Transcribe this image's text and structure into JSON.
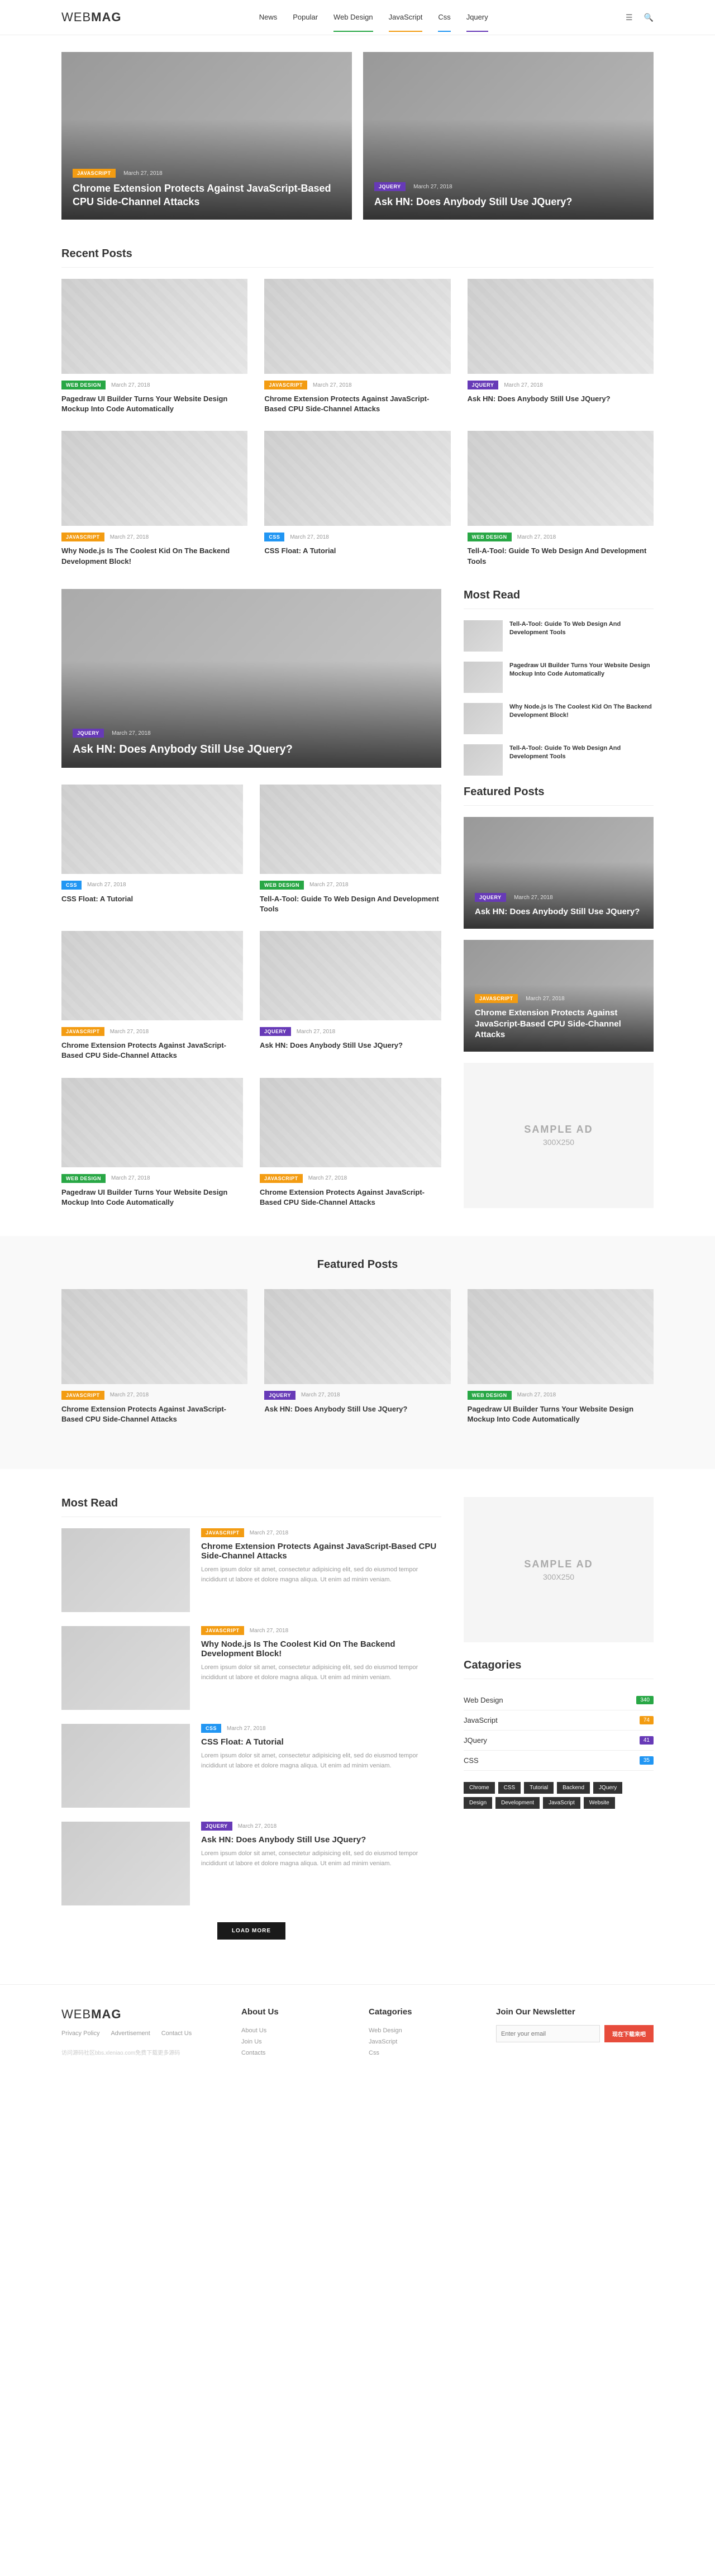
{
  "site": {
    "logo_a": "WEB",
    "logo_b": "MAG"
  },
  "nav": [
    "News",
    "Popular",
    "Web Design",
    "JavaScript",
    "Css",
    "Jquery"
  ],
  "hero": [
    {
      "tag": "JAVASCRIPT",
      "tag_cls": "tag-orange",
      "date": "March 27, 2018",
      "title": "Chrome Extension Protects Against JavaScript-Based CPU Side-Channel Attacks"
    },
    {
      "tag": "JQUERY",
      "tag_cls": "tag-purple",
      "date": "March 27, 2018",
      "title": "Ask HN: Does Anybody Still Use JQuery?"
    }
  ],
  "sections": {
    "recent": "Recent Posts",
    "most_read": "Most Read",
    "featured": "Featured Posts",
    "categories": "Catagories",
    "about": "About Us",
    "newsletter": "Join Our Newsletter"
  },
  "recent": [
    {
      "tag": "WEB DESIGN",
      "tag_cls": "tag-green",
      "date": "March 27, 2018",
      "title": "Pagedraw UI Builder Turns Your Website Design Mockup Into Code Automatically"
    },
    {
      "tag": "JAVASCRIPT",
      "tag_cls": "tag-orange",
      "date": "March 27, 2018",
      "title": "Chrome Extension Protects Against JavaScript-Based CPU Side-Channel Attacks"
    },
    {
      "tag": "JQUERY",
      "tag_cls": "tag-purple",
      "date": "March 27, 2018",
      "title": "Ask HN: Does Anybody Still Use JQuery?"
    },
    {
      "tag": "JAVASCRIPT",
      "tag_cls": "tag-orange",
      "date": "March 27, 2018",
      "title": "Why Node.js Is The Coolest Kid On The Backend Development Block!"
    },
    {
      "tag": "CSS",
      "tag_cls": "tag-blue",
      "date": "March 27, 2018",
      "title": "CSS Float: A Tutorial"
    },
    {
      "tag": "WEB DESIGN",
      "tag_cls": "tag-green",
      "date": "March 27, 2018",
      "title": "Tell-A-Tool: Guide To Web Design And Development Tools"
    }
  ],
  "big_post": {
    "tag": "JQUERY",
    "tag_cls": "tag-purple",
    "date": "March 27, 2018",
    "title": "Ask HN: Does Anybody Still Use JQuery?"
  },
  "mid_grid": [
    {
      "tag": "CSS",
      "tag_cls": "tag-blue",
      "date": "March 27, 2018",
      "title": "CSS Float: A Tutorial"
    },
    {
      "tag": "WEB DESIGN",
      "tag_cls": "tag-green",
      "date": "March 27, 2018",
      "title": "Tell-A-Tool: Guide To Web Design And Development Tools"
    },
    {
      "tag": "JAVASCRIPT",
      "tag_cls": "tag-orange",
      "date": "March 27, 2018",
      "title": "Chrome Extension Protects Against JavaScript-Based CPU Side-Channel Attacks"
    },
    {
      "tag": "JQUERY",
      "tag_cls": "tag-purple",
      "date": "March 27, 2018",
      "title": "Ask HN: Does Anybody Still Use JQuery?"
    },
    {
      "tag": "WEB DESIGN",
      "tag_cls": "tag-green",
      "date": "March 27, 2018",
      "title": "Pagedraw UI Builder Turns Your Website Design Mockup Into Code Automatically"
    },
    {
      "tag": "JAVASCRIPT",
      "tag_cls": "tag-orange",
      "date": "March 27, 2018",
      "title": "Chrome Extension Protects Against JavaScript-Based CPU Side-Channel Attacks"
    }
  ],
  "side_most_read": [
    {
      "title": "Tell-A-Tool: Guide To Web Design And Development Tools"
    },
    {
      "title": "Pagedraw UI Builder Turns Your Website Design Mockup Into Code Automatically"
    },
    {
      "title": "Why Node.js Is The Coolest Kid On The Backend Development Block!"
    },
    {
      "title": "Tell-A-Tool: Guide To Web Design And Development Tools"
    }
  ],
  "side_featured": [
    {
      "tag": "JQUERY",
      "tag_cls": "tag-purple",
      "date": "March 27, 2018",
      "title": "Ask HN: Does Anybody Still Use JQuery?"
    },
    {
      "tag": "JAVASCRIPT",
      "tag_cls": "tag-orange",
      "date": "March 27, 2018",
      "title": "Chrome Extension Protects Against JavaScript-Based CPU Side-Channel Attacks"
    }
  ],
  "ad": {
    "title": "SAMPLE AD",
    "size": "300X250"
  },
  "featured_band": [
    {
      "tag": "JAVASCRIPT",
      "tag_cls": "tag-orange",
      "date": "March 27, 2018",
      "title": "Chrome Extension Protects Against JavaScript-Based CPU Side-Channel Attacks"
    },
    {
      "tag": "JQUERY",
      "tag_cls": "tag-purple",
      "date": "March 27, 2018",
      "title": "Ask HN: Does Anybody Still Use JQuery?"
    },
    {
      "tag": "WEB DESIGN",
      "tag_cls": "tag-green",
      "date": "March 27, 2018",
      "title": "Pagedraw UI Builder Turns Your Website Design Mockup Into Code Automatically"
    }
  ],
  "mr_list": [
    {
      "tag": "JAVASCRIPT",
      "tag_cls": "tag-orange",
      "date": "March 27, 2018",
      "title": "Chrome Extension Protects Against JavaScript-Based CPU Side-Channel Attacks",
      "excerpt": "Lorem ipsum dolor sit amet, consectetur adipisicing elit, sed do eiusmod tempor incididunt ut labore et dolore magna aliqua. Ut enim ad minim veniam."
    },
    {
      "tag": "JAVASCRIPT",
      "tag_cls": "tag-orange",
      "date": "March 27, 2018",
      "title": "Why Node.js Is The Coolest Kid On The Backend Development Block!",
      "excerpt": "Lorem ipsum dolor sit amet, consectetur adipisicing elit, sed do eiusmod tempor incididunt ut labore et dolore magna aliqua. Ut enim ad minim veniam."
    },
    {
      "tag": "CSS",
      "tag_cls": "tag-blue",
      "date": "March 27, 2018",
      "title": "CSS Float: A Tutorial",
      "excerpt": "Lorem ipsum dolor sit amet, consectetur adipisicing elit, sed do eiusmod tempor incididunt ut labore et dolore magna aliqua. Ut enim ad minim veniam."
    },
    {
      "tag": "JQUERY",
      "tag_cls": "tag-purple",
      "date": "March 27, 2018",
      "title": "Ask HN: Does Anybody Still Use JQuery?",
      "excerpt": "Lorem ipsum dolor sit amet, consectetur adipisicing elit, sed do eiusmod tempor incididunt ut labore et dolore magna aliqua. Ut enim ad minim veniam."
    }
  ],
  "load_more": "LOAD MORE",
  "categories": [
    {
      "name": "Web Design",
      "count": "340",
      "cls": "c-green"
    },
    {
      "name": "JavaScript",
      "count": "74",
      "cls": "c-orange"
    },
    {
      "name": "JQuery",
      "count": "41",
      "cls": "c-purple"
    },
    {
      "name": "CSS",
      "count": "35",
      "cls": "c-blue"
    }
  ],
  "tags": [
    "Chrome",
    "CSS",
    "Tutorial",
    "Backend",
    "JQuery",
    "Design",
    "Development",
    "JavaScript",
    "Website"
  ],
  "footer": {
    "links": [
      "Privacy Policy",
      "Advertisement",
      "Contact Us"
    ],
    "about": [
      "About Us",
      "Join Us",
      "Contacts"
    ],
    "cats": [
      "Web Design",
      "JavaScript",
      "Css"
    ],
    "email_ph": "Enter your email",
    "subscribe": "现在下载来吧",
    "watermark": "访问源码社区bbs.xleniao.com免费下载更多源码"
  }
}
